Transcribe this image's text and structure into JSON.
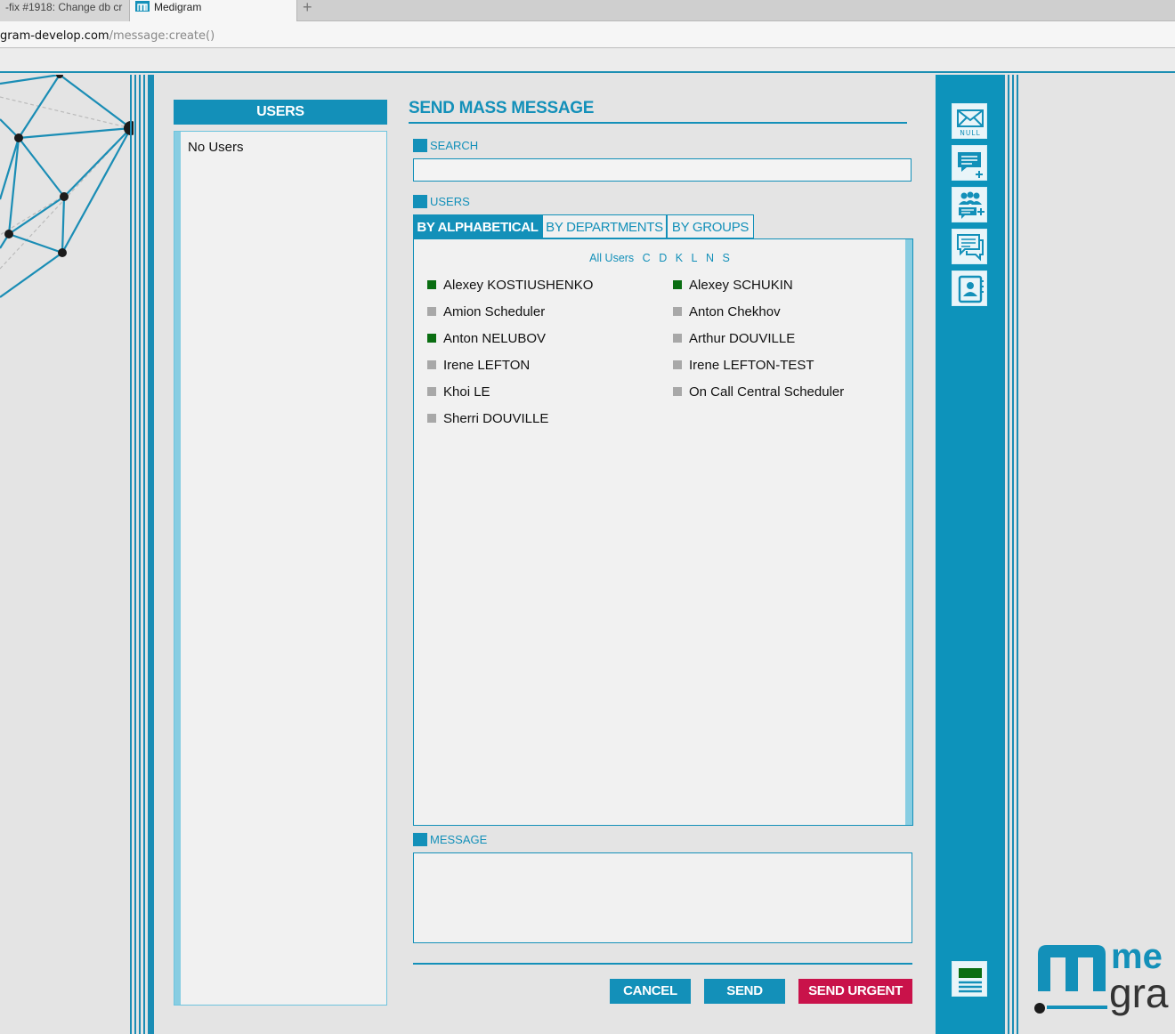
{
  "browser": {
    "tab_inactive_label": "-fix #1918: Change db cr",
    "tab_active_label": "Medigram",
    "new_tab_symbol": "+",
    "url_host": "gram-develop.com",
    "url_path": "/message:create()"
  },
  "left_panel": {
    "header": "USERS",
    "empty_text": "No Users"
  },
  "main": {
    "title": "SEND MASS MESSAGE",
    "search_label": "SEARCH",
    "search_value": "",
    "users_label": "USERS",
    "tabs": [
      {
        "label": "BY ALPHABETICAL",
        "active": true
      },
      {
        "label": "BY DEPARTMENTS",
        "active": false
      },
      {
        "label": "BY GROUPS",
        "active": false
      }
    ],
    "letter_filter": {
      "all": "All Users",
      "letters": [
        "C",
        "D",
        "K",
        "L",
        "N",
        "S"
      ]
    },
    "users": [
      {
        "name": "Alexey KOSTIUSHENKO",
        "status": "online"
      },
      {
        "name": "Alexey SCHUKIN",
        "status": "online"
      },
      {
        "name": "Amion Scheduler",
        "status": "offline"
      },
      {
        "name": "Anton Chekhov",
        "status": "offline"
      },
      {
        "name": "Anton NELUBOV",
        "status": "online"
      },
      {
        "name": "Arthur DOUVILLE",
        "status": "offline"
      },
      {
        "name": "Irene LEFTON",
        "status": "offline"
      },
      {
        "name": "Irene LEFTON-TEST",
        "status": "offline"
      },
      {
        "name": "Khoi LE",
        "status": "offline"
      },
      {
        "name": "On Call Central Scheduler",
        "status": "offline"
      },
      {
        "name": "Sherri DOUVILLE",
        "status": "offline"
      }
    ],
    "message_label": "MESSAGE",
    "message_value": "",
    "buttons": {
      "cancel": "CANCEL",
      "send": "SEND",
      "send_urgent": "SEND URGENT"
    }
  },
  "right_rail": {
    "buttons": [
      {
        "icon": "envelope-icon",
        "caption": "NULL"
      },
      {
        "icon": "new-chat-icon"
      },
      {
        "icon": "group-chat-icon"
      },
      {
        "icon": "conversations-icon"
      },
      {
        "icon": "contacts-icon"
      }
    ],
    "menu_icon": "menu-icon"
  },
  "logo": {
    "line1": "me",
    "line2": "gra",
    "mark": "m"
  },
  "colors": {
    "brand_blue": "#1390b9",
    "urgent_red": "#c9124a",
    "online_green": "#0a6e12",
    "offline_gray": "#a8a8a8"
  }
}
